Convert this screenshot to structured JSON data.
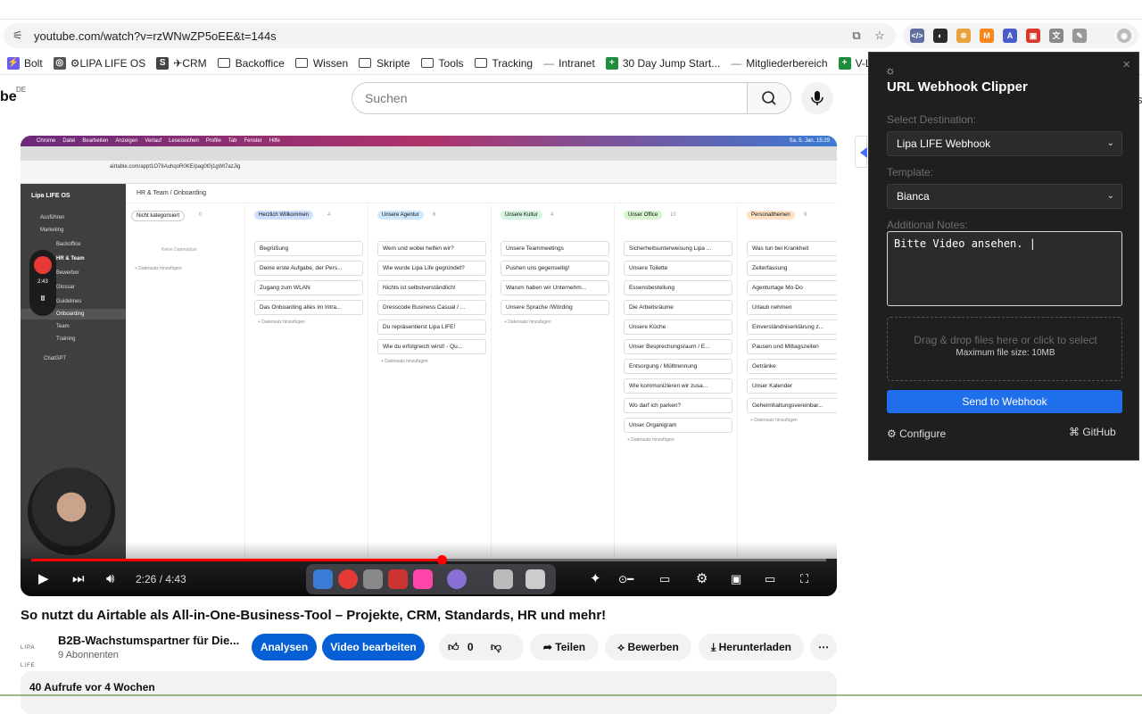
{
  "browser": {
    "url": "youtube.com/watch?v=rzWNwZP5oEE&t=144s",
    "bookmarks": [
      {
        "label": "Bolt",
        "icon": "bolt-icon",
        "color": "#6b5cf6"
      },
      {
        "label": "⚙LIPA LIFE OS",
        "icon": "notion-icon",
        "color": "#555555"
      },
      {
        "label": "✈CRM",
        "icon": "crm-icon",
        "color": "#444444"
      },
      {
        "label": "Backoffice",
        "icon": "folder-icon"
      },
      {
        "label": "Wissen",
        "icon": "folder-icon"
      },
      {
        "label": "Skripte",
        "icon": "folder-icon"
      },
      {
        "label": "Tools",
        "icon": "folder-icon"
      },
      {
        "label": "Tracking",
        "icon": "folder-icon"
      },
      {
        "label": "Intranet",
        "icon": "dash-icon"
      },
      {
        "label": "30 Day Jump Start...",
        "icon": "green-plus-icon",
        "color": "#1e8e3e"
      },
      {
        "label": "Mitgliederbereich",
        "icon": "dash-icon"
      },
      {
        "label": "V-Liste",
        "icon": "green-plus-icon",
        "color": "#1e8e3e"
      }
    ]
  },
  "youtube": {
    "logo_fragment": "be",
    "region": "DE",
    "search_placeholder": "Suchen",
    "video": {
      "title": "So nutzt du Airtable als All-in-One-Business-Tool – Projekte, CRM, Standards, HR und mehr!",
      "time": "2:26 / 4:43",
      "progress": 0.516
    },
    "channel": {
      "logo_text": "LIPA LIFE",
      "name": "B2B-Wachstumspartner für Die...",
      "subscribers": "9 Abonnenten"
    },
    "actions": {
      "analytics": "Analysen",
      "edit": "Video bearbeiten",
      "likes": "0",
      "share": "Teilen",
      "promote": "Bewerben",
      "download": "Herunterladen"
    },
    "stats": "40 Aufrufe  vor 4 Wochen"
  },
  "screen_recording": {
    "menubar": [
      "Chrome",
      "Datei",
      "Bearbeiten",
      "Anzeigen",
      "Verlauf",
      "Lesezeichen",
      "Profile",
      "Tab",
      "Fenster",
      "Hilfe"
    ],
    "clock": "Sa. 5. Jan. 15:29",
    "inner_url": "airtable.com/appt1O78AuhqoR0KE/pag0t0j1gWt7azJig",
    "workspace": "Lipa LIFE OS",
    "breadcrumb": "HR & Team  /  Onboarding",
    "rec_time": "2:43",
    "sidebar": [
      "Ausführen",
      "Marketing",
      "Backoffice",
      "HR & Team",
      "Bewerber",
      "Glossar",
      "Guidelines",
      "Onboarding",
      "Team",
      "Training",
      "ChatGPT"
    ],
    "columns": [
      {
        "name": "Nicht kategorisiert",
        "count": "0",
        "color": "#ffffff",
        "border": "#cccccc",
        "cards": [],
        "empty": "Keine Datensätze"
      },
      {
        "name": "Herzlich Willkommen",
        "count": "4",
        "color": "#cfe0ff",
        "cards": [
          "Begrüßung",
          "Deine erste Aufgabe, der Pers...",
          "Zugang zum WLAN",
          "Das Onboarding alles im Intra..."
        ]
      },
      {
        "name": "Unsere Agentur",
        "count": "6",
        "color": "#cde9ff",
        "cards": [
          "Wem und wobei helfen wir?",
          "Wie wurde Lipa Life gegründet?",
          "Nichts ist selbstverständlich!",
          "Dresscode Business Casual / ...",
          "Du repräsentierst Lipa LIFE!",
          "Wie du erfolgreich wirst! - Qu..."
        ]
      },
      {
        "name": "Unsere Kultur",
        "count": "4",
        "color": "#d5f5e0",
        "cards": [
          "Unsere Teammeetings",
          "Pushen uns gegenseitig!",
          "Warum haben wir Unternehm...",
          "Unsere Sprache /Wörding"
        ]
      },
      {
        "name": "Unser Office",
        "count": "10",
        "color": "#d8f3d0",
        "cards": [
          "Sicherheitsunterweisung Lipa ...",
          "Unsere Toilette",
          "Essensbestellung",
          "Die Arbeitsräume",
          "Unsere Küche",
          "Unser Besprechungsraum / E...",
          "Entsorgung / Mülltrennung",
          "Wie kommunizieren wir zusa...",
          "Wo darf ich parken?",
          "Unser Organigram"
        ]
      },
      {
        "name": "Personalthemen",
        "count": "9",
        "color": "#ffe2c6",
        "cards": [
          "Was tun bei Krankheit",
          "Zeiterfassung",
          "Agenturtage Mo-Do",
          "Urlaub nehmen",
          "Einverständniserklärung z...",
          "Pausen und Mittagszeiten",
          "Getränke",
          "Unser Kalender",
          "Geheimhaltungsvereinbar..."
        ]
      }
    ],
    "add_record": "+ Datensatz hinzufügen"
  },
  "extension": {
    "title": "URL Webhook Clipper",
    "destination_label": "Select Destination:",
    "destination_value": "Lipa LIFE Webhook",
    "template_label": "Template:",
    "template_value": "Bianca",
    "notes_label": "Additional Notes:",
    "notes_value": "Bitte Video ansehen. |",
    "drop_main": "Drag & drop files here or click to select",
    "drop_sub": "Maximum file size: 10MB",
    "send": "Send to Webhook",
    "configure": "Configure",
    "github": "GitHub"
  }
}
